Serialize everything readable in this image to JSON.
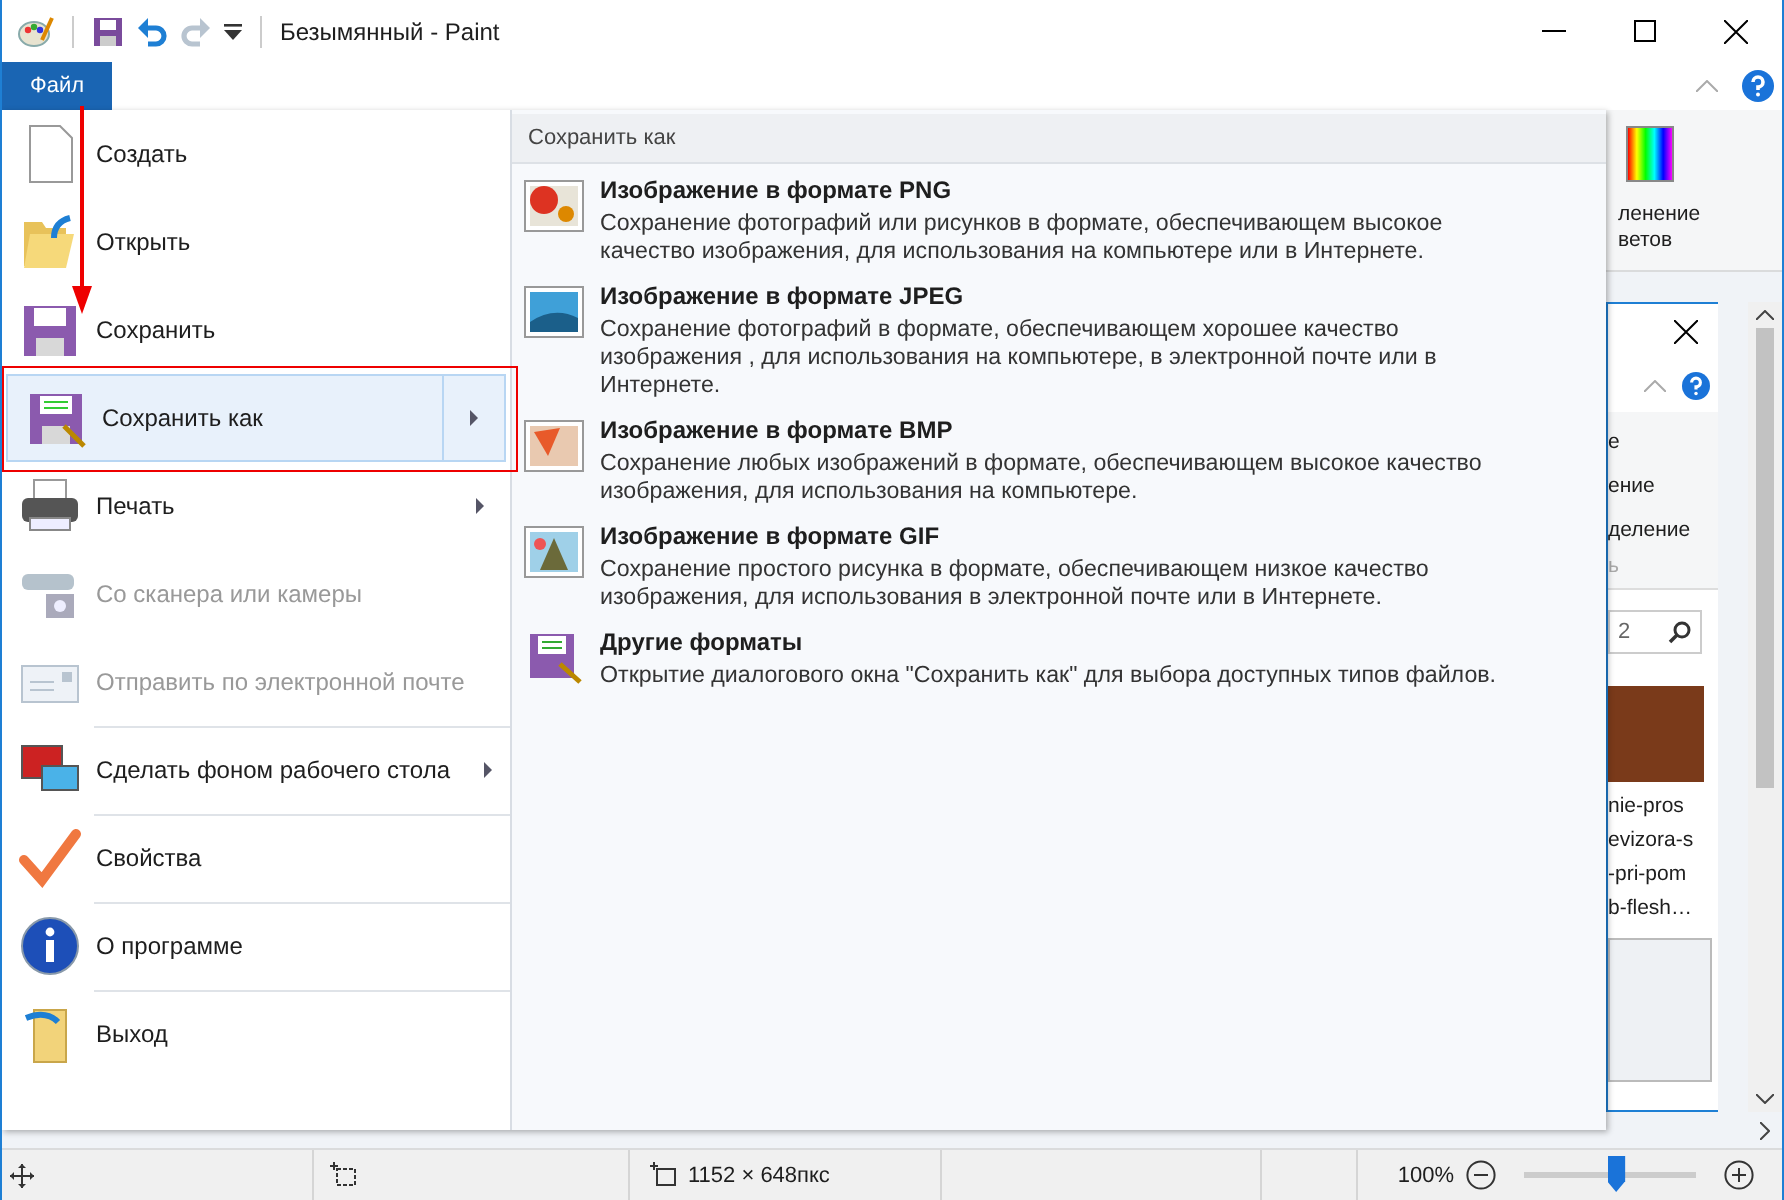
{
  "window": {
    "title": "Безымянный - Paint"
  },
  "file_tab": {
    "label": "Файл"
  },
  "menu": {
    "items": [
      {
        "label": "Создать",
        "disabled": false,
        "selected": false,
        "submenu": false
      },
      {
        "label": "Открыть",
        "disabled": false,
        "selected": false,
        "submenu": false
      },
      {
        "label": "Сохранить",
        "disabled": false,
        "selected": false,
        "submenu": false
      },
      {
        "label": "Сохранить как",
        "disabled": false,
        "selected": true,
        "submenu": true
      },
      {
        "label": "Печать",
        "disabled": false,
        "selected": false,
        "submenu": true
      },
      {
        "label": "Со сканера или камеры",
        "disabled": true,
        "selected": false,
        "submenu": false
      },
      {
        "label": "Отправить по электронной почте",
        "disabled": true,
        "selected": false,
        "submenu": false
      },
      {
        "label": "Сделать фоном рабочего стола",
        "disabled": false,
        "selected": false,
        "submenu": true
      },
      {
        "label": "Свойства",
        "disabled": false,
        "selected": false,
        "submenu": false
      },
      {
        "label": "О программе",
        "disabled": false,
        "selected": false,
        "submenu": false
      },
      {
        "label": "Выход",
        "disabled": false,
        "selected": false,
        "submenu": false
      }
    ]
  },
  "submenu": {
    "title": "Сохранить как",
    "items": [
      {
        "title": "Изображение в формате PNG",
        "description": "Сохранение фотографий или рисунков в формате, обеспечивающем высокое качество изображения, для использования на компьютере или в Интернете."
      },
      {
        "title": "Изображение в формате JPEG",
        "description": "Сохранение фотографий в формате, обеспечивающем хорошее качество изображения , для использования на компьютере, в электронной почте или в Интернете."
      },
      {
        "title": "Изображение в формате BMP",
        "description": "Сохранение любых изображений в формате, обеспечивающем высокое качество изображения, для использования на компьютере."
      },
      {
        "title": "Изображение в формате GIF",
        "description": "Сохранение простого рисунка в формате, обеспечивающем низкое качество изображения, для использования в электронной почте или в Интернете."
      },
      {
        "title": "Другие форматы",
        "description": "Открытие диалогового окна \"Сохранить как\" для выбора доступных типов файлов."
      }
    ]
  },
  "background": {
    "ribbon_label": [
      "ленение",
      "ветов"
    ],
    "explorer_texts": [
      "е",
      "ение",
      "деление",
      "ь"
    ],
    "search_value": "2",
    "file_name_lines": [
      "nie-pros",
      "evizora-s",
      "-pri-pom",
      "b-flesh…"
    ]
  },
  "status_bar": {
    "size": "1152 × 648пкс",
    "zoom": "100%",
    "zoom_level": {
      "level": 0.53
    }
  }
}
